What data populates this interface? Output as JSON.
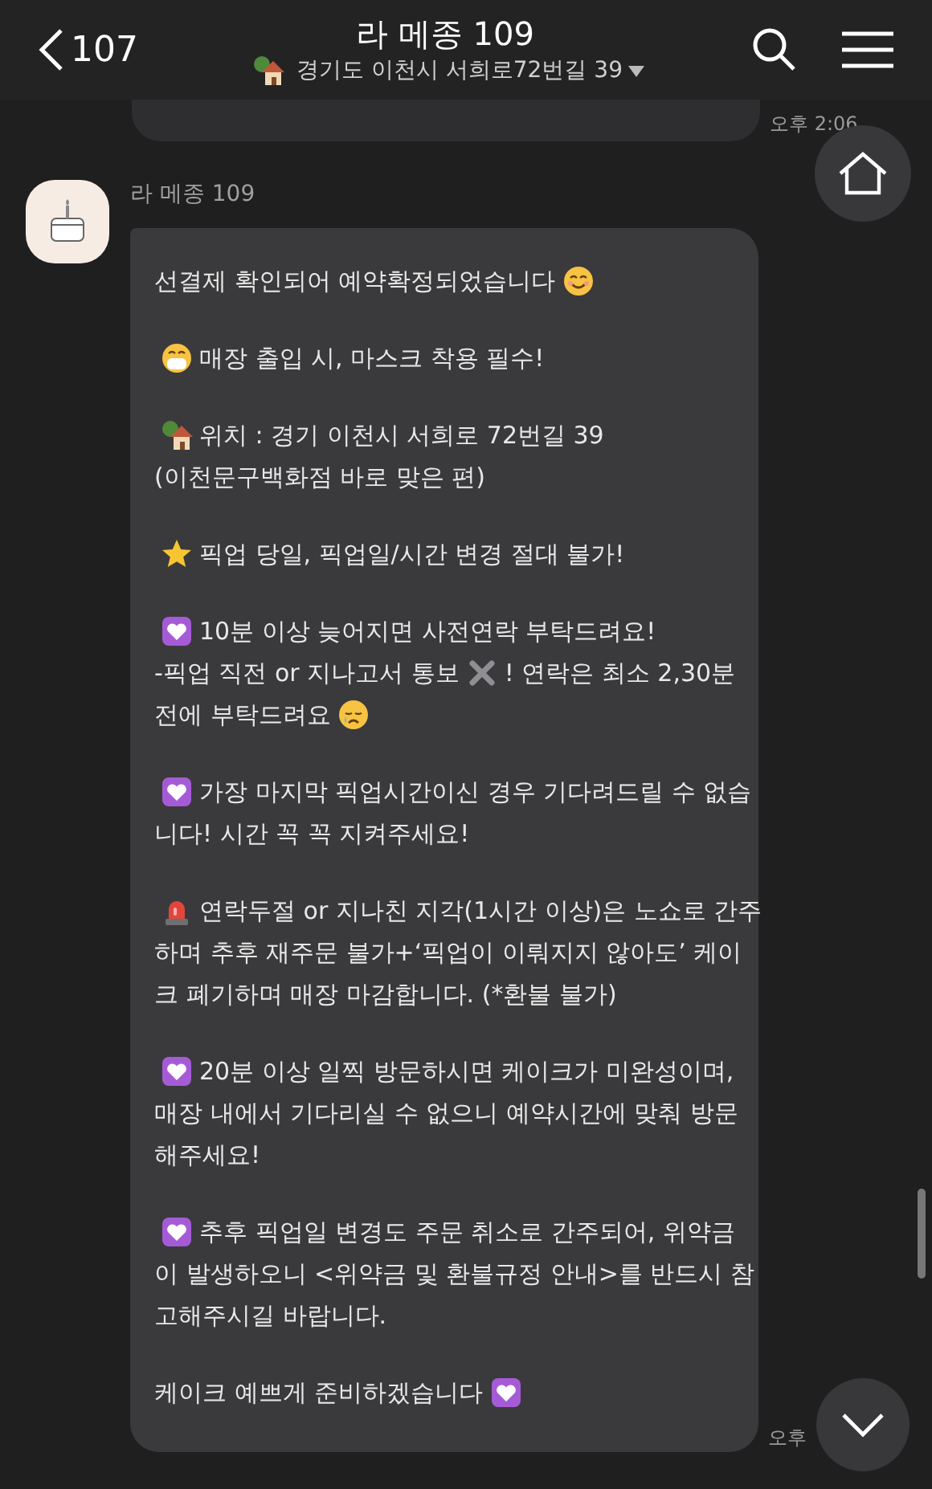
{
  "header": {
    "back_label": "107",
    "title": "라 메종 109",
    "subtitle": "경기도 이천시 서희로72번길 39"
  },
  "previous_message": {
    "time": "오후 2:06"
  },
  "message": {
    "sender": "라 메종 109",
    "time": "오후",
    "paragraphs": [
      {
        "lines": [
          [
            {
              "text": "선결제 확인되어 예약확정되었습니다"
            },
            {
              "kind": "smile"
            }
          ]
        ]
      },
      {
        "lines": [
          [
            {
              "kind": "mask"
            },
            {
              "text": "매장 출입 시, 마스크 착용 필수!"
            }
          ]
        ]
      },
      {
        "lines": [
          [
            {
              "kind": "house"
            },
            {
              "text": "위치 : 경기 이천시 서희로 72번길 39"
            }
          ],
          [
            {
              "text": "(이천문구백화점 바로 맞은 편)"
            }
          ]
        ]
      },
      {
        "lines": [
          [
            {
              "kind": "star"
            },
            {
              "text": "픽업 당일, 픽업일/시간 변경 절대 불가!"
            }
          ]
        ]
      },
      {
        "lines": [
          [
            {
              "kind": "heart"
            },
            {
              "text": "10분 이상 늦어지면 사전연락 부탁드려요!"
            }
          ],
          [
            {
              "text": "-픽업 직전 or 지나고서 통보"
            },
            {
              "kind": "cross"
            },
            {
              "text": "! 연락은 최소 2,30분"
            }
          ],
          [
            {
              "text": "전에 부탁드려요"
            },
            {
              "kind": "cry"
            }
          ]
        ]
      },
      {
        "lines": [
          [
            {
              "kind": "heart"
            },
            {
              "text": "가장 마지막 픽업시간이신 경우 기다려드릴 수 없습"
            }
          ],
          [
            {
              "text": "니다! 시간 꼭 꼭 지켜주세요!"
            }
          ]
        ]
      },
      {
        "lines": [
          [
            {
              "kind": "siren"
            },
            {
              "text": "연락두절 or 지나친 지각(1시간 이상)은 노쇼로 간주"
            }
          ],
          [
            {
              "text": "하며 추후 재주문 불가+‘픽업이 이뤄지지 않아도’ 케이"
            }
          ],
          [
            {
              "text": "크 폐기하며 매장 마감합니다. (*환불 불가)"
            }
          ]
        ]
      },
      {
        "lines": [
          [
            {
              "kind": "heart"
            },
            {
              "text": "20분 이상 일찍 방문하시면 케이크가 미완성이며,"
            }
          ],
          [
            {
              "text": "매장 내에서 기다리실 수 없으니 예약시간에 맞춰 방문"
            }
          ],
          [
            {
              "text": "해주세요!"
            }
          ]
        ]
      },
      {
        "lines": [
          [
            {
              "kind": "heart"
            },
            {
              "text": "추후 픽업일 변경도 주문 취소로 간주되어, 위약금"
            }
          ],
          [
            {
              "text": "이 발생하오니 <위약금 및 환불규정 안내>를 반드시 참"
            }
          ],
          [
            {
              "text": "고해주시길 바랍니다."
            }
          ]
        ]
      },
      {
        "lines": [
          [
            {
              "text": "케이크 예쁘게 준비하겠습니다"
            },
            {
              "kind": "heart"
            }
          ]
        ]
      }
    ]
  }
}
